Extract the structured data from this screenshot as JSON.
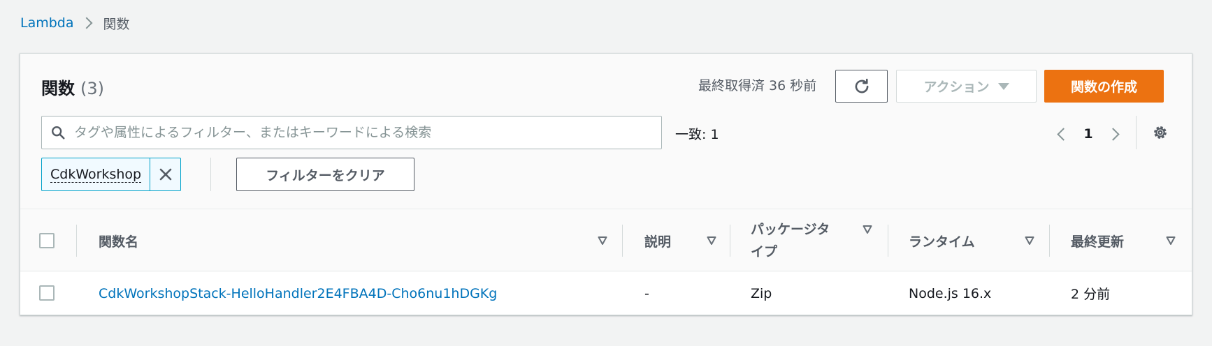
{
  "breadcrumb": {
    "root": "Lambda",
    "current": "関数"
  },
  "header": {
    "title": "関数",
    "count": "(3)"
  },
  "toolbar": {
    "last_fetched": "最終取得済 36 秒前",
    "actions_label": "アクション",
    "create_label": "関数の作成"
  },
  "search": {
    "placeholder": "タグや属性によるフィルター、またはキーワードによる検索",
    "value": ""
  },
  "match_count": "一致: 1",
  "pagination": {
    "current_page": "1"
  },
  "filter_token": {
    "label": "CdkWorkshop"
  },
  "clear_filter_label": "フィルターをクリア",
  "table": {
    "columns": [
      "関数名",
      "説明",
      "パッケージタ",
      "イプ",
      "ランタイム",
      "最終更新"
    ],
    "rows": [
      {
        "function_name": "CdkWorkshopStack-HelloHandler2E4FBA4D-Cho6nu1hDGKg",
        "description": "-",
        "package_type": "Zip",
        "runtime": "Node.js 16.x",
        "last_modified": "2 分前"
      }
    ]
  },
  "colors": {
    "accent": "#ec7211",
    "link": "#0073bb",
    "token_border": "#00a1c9"
  },
  "icons": [
    "chevron-right-icon",
    "refresh-icon",
    "caret-down-icon",
    "search-icon",
    "chevron-left-icon",
    "gear-icon",
    "close-icon",
    "sort-icon"
  ]
}
